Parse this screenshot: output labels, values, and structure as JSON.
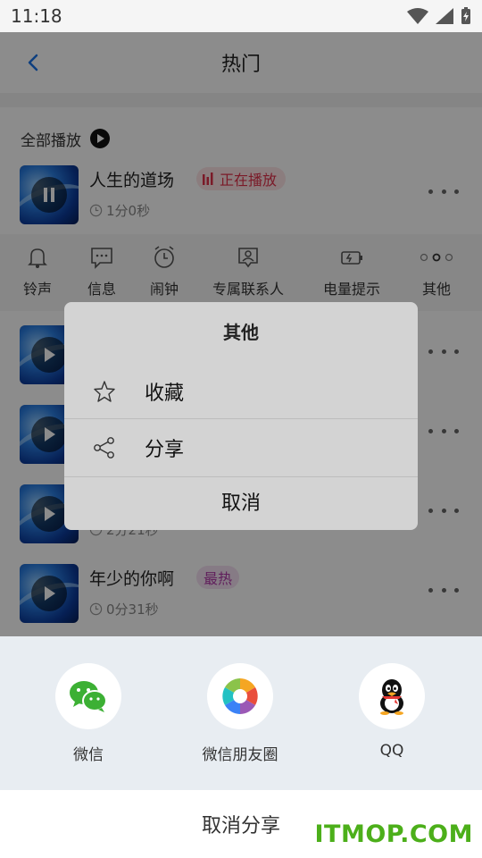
{
  "status_bar": {
    "time": "11:18"
  },
  "header": {
    "title": "热门"
  },
  "play_all": {
    "label": "全部播放"
  },
  "songs": [
    {
      "title": "人生的道场",
      "duration": "1分0秒",
      "badge": "正在播放",
      "state": "playing"
    },
    {
      "title": "",
      "duration": "",
      "badge": "",
      "state": "paused"
    },
    {
      "title": "",
      "duration": "",
      "badge": "",
      "state": "paused"
    },
    {
      "title": "",
      "duration": "2分21秒",
      "badge": "",
      "state": "paused"
    },
    {
      "title": "年少的你啊",
      "duration": "0分31秒",
      "badge": "最热",
      "state": "paused"
    }
  ],
  "actions": [
    {
      "label": "铃声",
      "icon": "bell-icon"
    },
    {
      "label": "信息",
      "icon": "message-icon"
    },
    {
      "label": "闹钟",
      "icon": "alarm-icon"
    },
    {
      "label": "专属联系人",
      "icon": "contact-icon"
    },
    {
      "label": "电量提示",
      "icon": "battery-icon"
    },
    {
      "label": "其他",
      "icon": "more-icon"
    }
  ],
  "dialog": {
    "title": "其他",
    "options": [
      {
        "label": "收藏",
        "icon": "star-icon"
      },
      {
        "label": "分享",
        "icon": "share-icon"
      }
    ],
    "cancel": "取消"
  },
  "share_sheet": {
    "targets": [
      {
        "label": "微信",
        "icon": "wechat-icon",
        "color": "#3cb034"
      },
      {
        "label": "微信朋友圈",
        "icon": "moments-icon",
        "color": "#f5a623"
      },
      {
        "label": "QQ",
        "icon": "qq-icon",
        "color": "#000000"
      }
    ],
    "cancel": "取消分享"
  },
  "watermark": "ITMOP.COM",
  "colors": {
    "accent": "#1a73e8",
    "playing_badge": "#e0304a",
    "hot_badge": "#b03aa8",
    "watermark": "#4caf1a"
  }
}
